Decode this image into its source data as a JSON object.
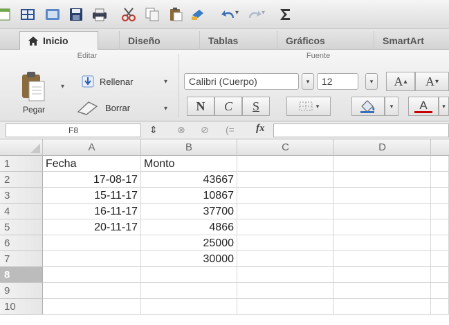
{
  "toolbar": {
    "buttons": [
      "new-sheet-icon",
      "grid-icon",
      "gallery-icon",
      "save-icon",
      "print-icon",
      "cut-icon",
      "copy-icon",
      "paste-icon",
      "format-painter-icon",
      "undo-icon",
      "redo-icon",
      "autosum-icon"
    ],
    "undo_arrow": "▾",
    "redo_arrow": "▾"
  },
  "tabs": [
    {
      "label": "Inicio",
      "active": true
    },
    {
      "label": "Diseño"
    },
    {
      "label": "Tablas"
    },
    {
      "label": "Gráficos"
    },
    {
      "label": "SmartArt"
    }
  ],
  "ribbon": {
    "editar": {
      "title": "Editar",
      "paste_label": "Pegar",
      "fill_label": "Rellenar",
      "clear_label": "Borrar"
    },
    "fuente": {
      "title": "Fuente",
      "font_name": "Calibri (Cuerpo)",
      "font_size": "12",
      "bold": "N",
      "italic": "C",
      "underline": "S",
      "grow": "A",
      "shrink": "A",
      "font_color_letter": "A",
      "accent_color": "#cc0000"
    }
  },
  "formula_bar": {
    "cell_ref": "F8",
    "fx": "fx",
    "value": ""
  },
  "sheet": {
    "columns": [
      "A",
      "B",
      "C",
      "D"
    ],
    "rows": [
      {
        "n": "1",
        "a": "Fecha",
        "b": "Monto"
      },
      {
        "n": "2",
        "a": "17-08-17",
        "b": "43667"
      },
      {
        "n": "3",
        "a": "15-11-17",
        "b": "10867"
      },
      {
        "n": "4",
        "a": "16-11-17",
        "b": "37700"
      },
      {
        "n": "5",
        "a": "20-11-17",
        "b": "4866"
      },
      {
        "n": "6",
        "a": "",
        "b": "25000"
      },
      {
        "n": "7",
        "a": "",
        "b": "30000"
      },
      {
        "n": "8",
        "a": "",
        "b": ""
      },
      {
        "n": "9",
        "a": "",
        "b": ""
      },
      {
        "n": "10",
        "a": "",
        "b": ""
      }
    ],
    "selected_row": "8"
  }
}
